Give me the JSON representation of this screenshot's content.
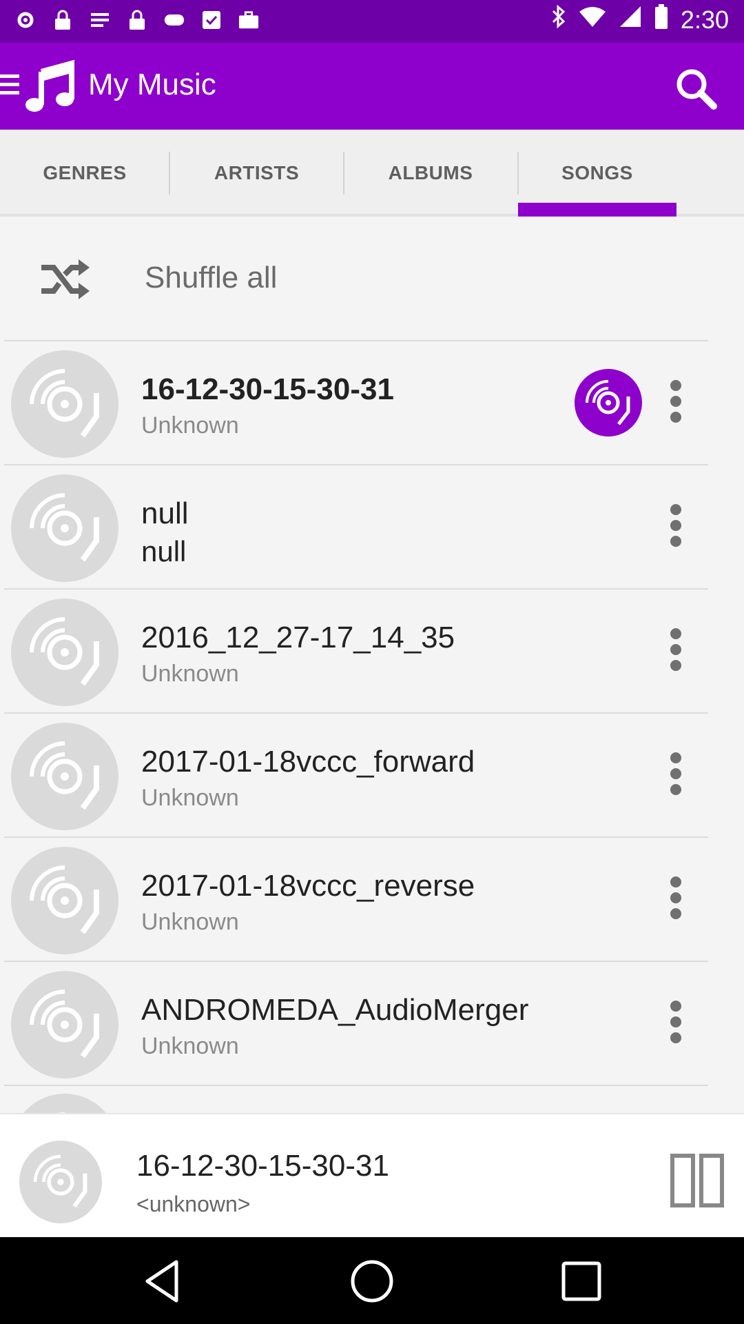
{
  "status_bar": {
    "time": "2:30",
    "icons": [
      "settings-icon",
      "lock-icon",
      "text-icon",
      "lock-icon",
      "gamepad-icon",
      "checkbox-icon",
      "briefcase-icon",
      "bluetooth-icon",
      "wifi-icon",
      "signal-icon",
      "battery-icon"
    ]
  },
  "app_bar": {
    "title": "My Music",
    "menu_icon": "hamburger-menu-icon",
    "logo_icon": "music-note-icon",
    "search_icon": "search-icon"
  },
  "tabs": [
    {
      "label": "GENRES",
      "active": false
    },
    {
      "label": "ARTISTS",
      "active": false
    },
    {
      "label": "ALBUMS",
      "active": false
    },
    {
      "label": "SONGS",
      "active": true
    }
  ],
  "shuffle": {
    "label": "Shuffle all",
    "icon": "shuffle-icon"
  },
  "songs": [
    {
      "title": "16-12-30-15-30-31",
      "artist": "Unknown",
      "now_playing": true
    },
    {
      "title": "null",
      "artist": "null",
      "now_playing": false
    },
    {
      "title": "2016_12_27-17_14_35",
      "artist": "Unknown",
      "now_playing": false
    },
    {
      "title": "2017-01-18vccc_forward",
      "artist": "Unknown",
      "now_playing": false
    },
    {
      "title": "2017-01-18vccc_reverse",
      "artist": "Unknown",
      "now_playing": false
    },
    {
      "title": "ANDROMEDA_AudioMerger",
      "artist": "Unknown",
      "now_playing": false
    }
  ],
  "mini_player": {
    "title": "16-12-30-15-30-31",
    "artist": "<unknown>",
    "control_icon": "pause-icon"
  },
  "nav_bar": [
    "back-icon",
    "home-icon",
    "recents-icon"
  ],
  "colors": {
    "accent": "#8e00cc",
    "status_bar": "#6e00a8",
    "background": "#f4f4f4"
  }
}
